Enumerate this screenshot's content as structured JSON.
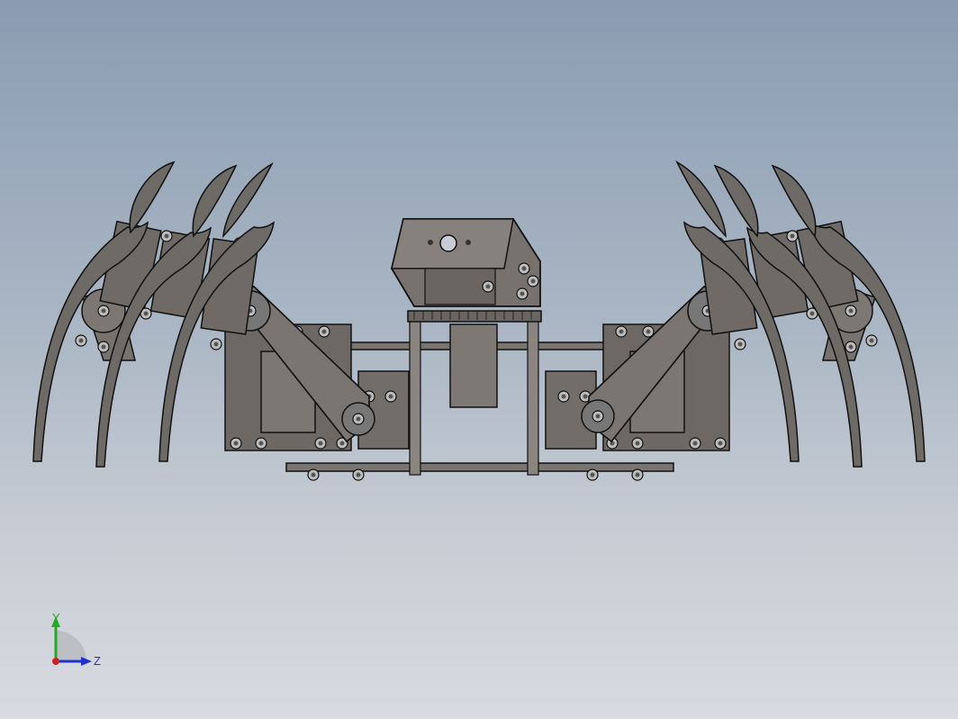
{
  "viewport": {
    "background_top": "#8a9cb2",
    "background_bottom": "#d8dbe0",
    "model": "hexapod-robot-front-view",
    "part_fill": "#6e6a66",
    "part_stroke": "#1a1a1a"
  },
  "triad": {
    "y_label": "Y",
    "z_label": "Z",
    "y_color": "#22aa22",
    "z_color": "#2233cc",
    "origin_color": "#cc2222"
  }
}
